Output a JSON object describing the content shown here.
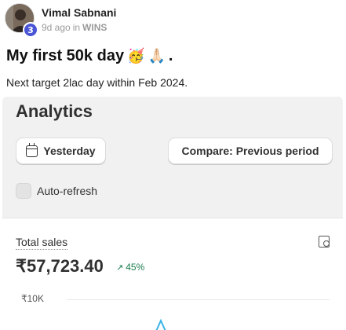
{
  "post": {
    "author": "Vimal Sabnani",
    "level": "3",
    "time": "9d ago",
    "in_word": "in",
    "category": "WINS",
    "title": "My first 50k day",
    "title_emojis": [
      "🥳",
      "🙏🏻"
    ],
    "title_end": ".",
    "body": "Next target 2lac day within Feb 2024."
  },
  "analytics": {
    "title": "Analytics",
    "date_button": "Yesterday",
    "compare_button": "Compare: Previous period",
    "auto_refresh_label": "Auto-refresh",
    "auto_refresh_checked": false,
    "card": {
      "label": "Total sales",
      "value": "₹57,723.40",
      "change": "45%",
      "change_direction": "up",
      "change_color": "#1a7d4f",
      "axis_tick": "₹10K"
    }
  }
}
